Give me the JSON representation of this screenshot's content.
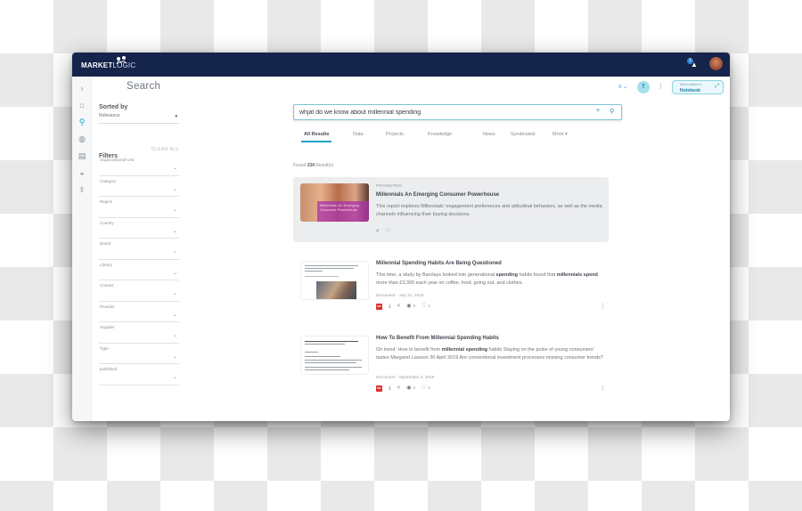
{
  "app": {
    "logo_bold": "MARKET",
    "logo_light": "LOGIC",
    "notification_count": "1",
    "brand_color": "#14244a",
    "accent_color": "#1aa2c4"
  },
  "rail": {
    "items": [
      {
        "icon": "chevron-right-icon",
        "glyph": "›"
      },
      {
        "icon": "home-icon",
        "glyph": "⌂"
      },
      {
        "icon": "search-icon",
        "glyph": "⚲"
      },
      {
        "icon": "globe-icon",
        "glyph": "◍"
      },
      {
        "icon": "documents-icon",
        "glyph": "▤"
      },
      {
        "icon": "graduation-cap-icon",
        "glyph": "◒"
      },
      {
        "icon": "upload-icon",
        "glyph": "⇪"
      }
    ]
  },
  "page": {
    "title": "Search"
  },
  "toolbar": {
    "add_content_line1": "Add content to",
    "add_content_line2": "Notebook",
    "filter_glyph": "T",
    "more_glyph": "⋮",
    "view_glyph": "≡ ⌄",
    "expand_glyph": "⤢"
  },
  "sidebar": {
    "sorted_by_label": "Sorted by",
    "sort_value": "Relevance",
    "filters_title": "Filters",
    "clear_all": "CLEAR ALL",
    "filters": [
      {
        "label": "Organizational Unit"
      },
      {
        "label": "Category"
      },
      {
        "label": "Region"
      },
      {
        "label": "Country"
      },
      {
        "label": "Brand"
      },
      {
        "label": "Library"
      },
      {
        "label": "Contact"
      },
      {
        "label": "Provider"
      },
      {
        "label": "Supplier"
      },
      {
        "label": "Type"
      },
      {
        "label": "published"
      }
    ]
  },
  "search": {
    "query": "whjat do we know about millennial spending",
    "clear_glyph": "×",
    "go_glyph": "⚲"
  },
  "tabs": [
    {
      "label": "All Results",
      "active": true
    },
    {
      "label": "Data"
    },
    {
      "label": "Projects"
    },
    {
      "label": "Knowledge"
    },
    {
      "label": "News"
    },
    {
      "label": "Syndicated"
    },
    {
      "label": "More ▾"
    }
  ],
  "results_summary": {
    "prefix": "Found ",
    "count": "334",
    "suffix": " Result(s)"
  },
  "promoted": {
    "tag": "PROMOTED",
    "title": "Millennials An Emerging Consumer Powerhouse",
    "description": "This report explores Millennials' engagement preferences and attitudinal behaviors, as well as the media channels influencing their buying decisions.",
    "thumb_text": "Millennials: An Emerging Consumer Powerhouse"
  },
  "results": [
    {
      "title": "Millennial Spending Habits Are Being Questioned",
      "desc_parts": [
        {
          "t": "This time, a study by Barclays looked into generational "
        },
        {
          "t": "spending",
          "b": true
        },
        {
          "t": " habits found that "
        },
        {
          "t": "millennials spend",
          "b": true
        },
        {
          "t": " more than £3,300 each year on coffee, food, going out, and clothes."
        }
      ],
      "meta": "Document - July 31, 2019",
      "views": "3",
      "likes": "1"
    },
    {
      "title": "How To Benefit From Millennial Spending Habits",
      "desc_parts": [
        {
          "t": "On trend: How to benefit from "
        },
        {
          "t": "millennial spending",
          "b": true
        },
        {
          "t": " habits Staying on the pulse of young consumers' tastes Margaret Lawson 30 April 2019 Are conventional investment processes missing consumer trends?"
        }
      ],
      "meta": "Document - September 4, 2019",
      "views": "4",
      "likes": "1"
    }
  ],
  "sections": {
    "news": "News"
  },
  "glyphs": {
    "pdf": "PDF",
    "download": "⤓",
    "share": "<",
    "eye": "◉",
    "heart": "♡",
    "kebab": "⋮",
    "caret": "▾",
    "chevron_down": "⌄"
  }
}
